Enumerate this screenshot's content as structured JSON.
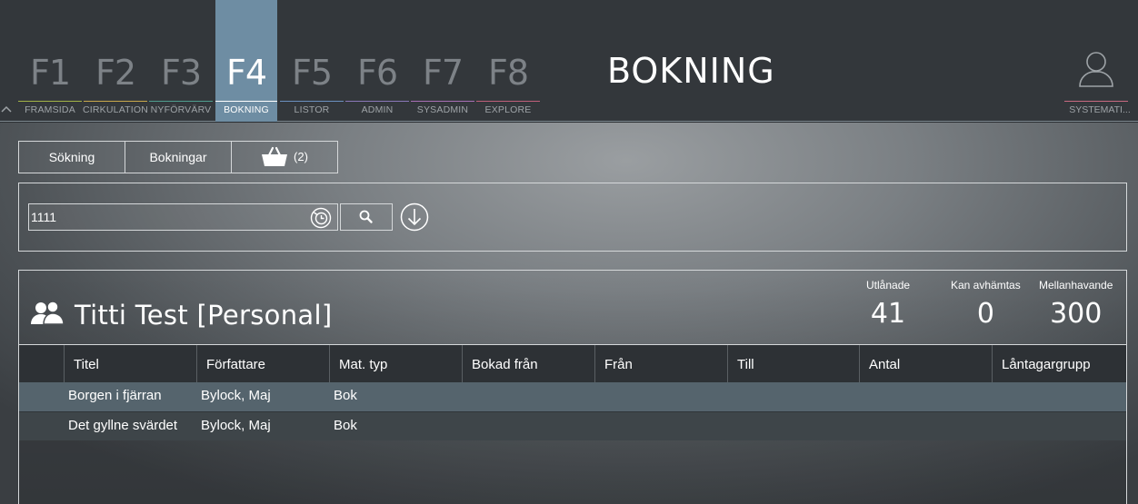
{
  "topbar": {
    "title": "BOKNING",
    "fkeys": [
      {
        "key": "F1",
        "label": "FRAMSIDA",
        "color": "#a3b347"
      },
      {
        "key": "F2",
        "label": "CIRKULATION",
        "color": "#c8a84b"
      },
      {
        "key": "F3",
        "label": "NYFÖRVÄRV",
        "color": "#4f9d8f"
      },
      {
        "key": "F4",
        "label": "BOKNING",
        "color": "#6e8da3",
        "active": true
      },
      {
        "key": "F5",
        "label": "LISTOR",
        "color": "#6b8fbf"
      },
      {
        "key": "F6",
        "label": "ADMIN",
        "color": "#8a78b8"
      },
      {
        "key": "F7",
        "label": "SYSADMIN",
        "color": "#a86fb5"
      },
      {
        "key": "F8",
        "label": "EXPLORE",
        "color": "#c0607a"
      }
    ],
    "user_label": "SYSTEMATI...",
    "icons": {
      "collapse": "chevron-up-icon",
      "user": "user-icon"
    }
  },
  "tabs": {
    "search": "Sökning",
    "bookings": "Bokningar",
    "basket_count": "(2)",
    "basket_icon": "basket-icon"
  },
  "search": {
    "value": "1111",
    "icons": {
      "history": "clock-icon",
      "search": "search-icon",
      "download": "download-icon"
    }
  },
  "patron": {
    "name": "Titti Test [Personal]",
    "icon": "users-icon",
    "stats": {
      "loaned_label": "Utlånade",
      "loaned_value": "41",
      "pickup_label": "Kan avhämtas",
      "pickup_value": "0",
      "balance_label": "Mellanhavande",
      "balance_value": "300"
    }
  },
  "table": {
    "columns": [
      "",
      "Titel",
      "Författare",
      "Mat. typ",
      "Bokad från",
      "Från",
      "Till",
      "Antal",
      "Låntagargrupp"
    ],
    "rows": [
      [
        "",
        "Borgen i fjärran",
        "Bylock, Maj",
        "Bok",
        "",
        "",
        "",
        "",
        ""
      ],
      [
        "",
        "Det gyllne svärdet",
        "Bylock, Maj",
        "Bok",
        "",
        "",
        "",
        "",
        ""
      ]
    ]
  }
}
